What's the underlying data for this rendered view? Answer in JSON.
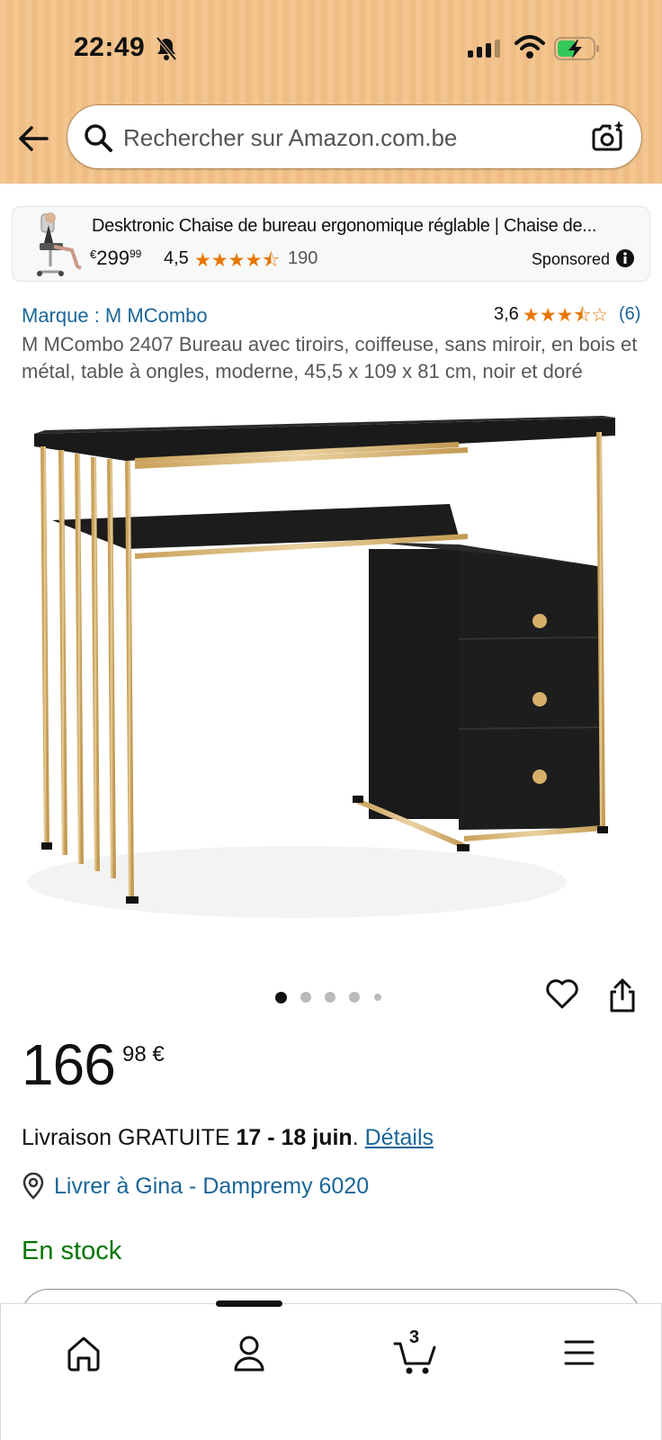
{
  "status_bar": {
    "time": "22:49",
    "icons": [
      "bell-off-icon",
      "signal-icon",
      "wifi-icon",
      "battery-charging-icon"
    ]
  },
  "search": {
    "placeholder": "Rechercher sur Amazon.com.be",
    "icons": [
      "back-arrow-icon",
      "search-icon",
      "camera-icon"
    ]
  },
  "sponsored_ad": {
    "title": "Desktronic Chaise de bureau ergonomique réglable | Chaise de...",
    "price_currency": "€",
    "price_whole": "299",
    "price_fraction": "99",
    "rating": "4,5",
    "stars": "★★★★⯪",
    "review_count": "190",
    "label": "Sponsored"
  },
  "product": {
    "brand": "Marque : M MCombo",
    "rating": "3,6",
    "stars": "★★★⯪☆",
    "review_count": "(6)",
    "title": "M MCombo 2407 Bureau avec tiroirs, coiffeuse, sans miroir, en bois et métal, table à ongles, moderne, 45,5 x 109 x 81 cm, noir et doré",
    "image_count": 5,
    "active_image": 1,
    "price_whole": "166",
    "price_fraction": "98 €",
    "delivery_prefix": "Livraison GRATUITE ",
    "delivery_dates": "17 - 18 juin",
    "delivery_suffix": ". ",
    "delivery_link": "Détails",
    "location": "Livrer à Gina - Dampremy 6020",
    "stock": "En stock"
  },
  "bottom_nav": {
    "items": [
      "home-icon",
      "account-icon",
      "cart-icon",
      "menu-icon"
    ],
    "cart_count": "3"
  },
  "colors": {
    "header": "#f3c58f",
    "link": "#1b6699",
    "star": "#e77600",
    "stock": "#007600"
  }
}
